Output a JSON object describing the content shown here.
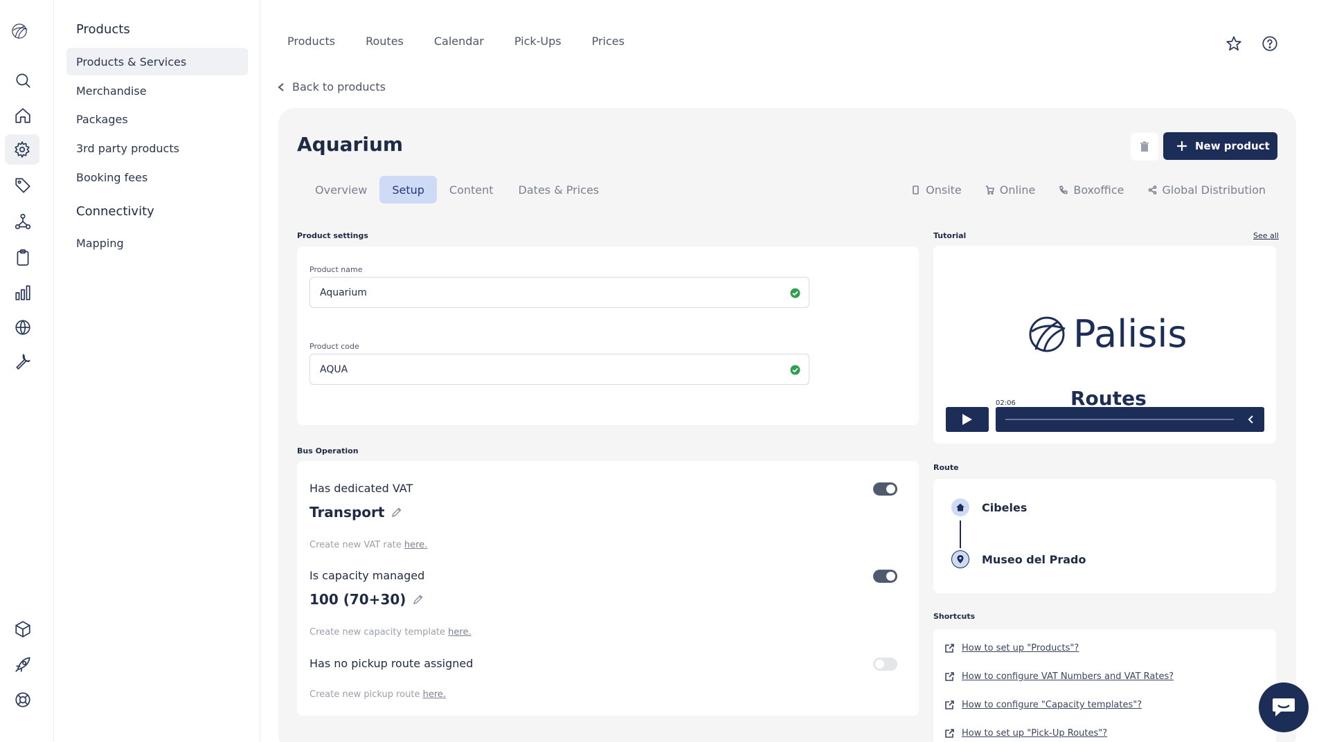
{
  "sidebar": {
    "section_products": "Products",
    "items_products": [
      "Products & Services",
      "Merchandise",
      "Packages",
      "3rd party products",
      "Booking fees"
    ],
    "section_connectivity": "Connectivity",
    "items_connectivity": [
      "Mapping"
    ]
  },
  "topnav": [
    "Products",
    "Routes",
    "Calendar",
    "Pick-Ups",
    "Prices"
  ],
  "back_label": "Back to products",
  "product": {
    "title": "Aquarium",
    "new_button": "New product",
    "tabs": [
      "Overview",
      "Setup",
      "Content",
      "Dates & Prices"
    ],
    "active_tab": "Setup",
    "channels": [
      "Onsite",
      "Online",
      "Boxoffice",
      "Global Distribution"
    ]
  },
  "settings": {
    "section_label": "Product settings",
    "name_label": "Product name",
    "name_value": "Aquarium",
    "code_label": "Product code",
    "code_value": "AQUA"
  },
  "bus": {
    "section_label": "Bus Operation",
    "vat_label": "Has dedicated VAT",
    "vat_value": "Transport",
    "vat_hint": "Create new VAT rate ",
    "vat_link": "here.",
    "vat_on": true,
    "capacity_label": "Is capacity managed",
    "capacity_value": "100 (70+30)",
    "capacity_hint": "Create new capacity template ",
    "capacity_link": "here.",
    "capacity_on": true,
    "pickup_label": "Has no pickup route assigned",
    "pickup_hint": "Create new pickup route ",
    "pickup_link": "here.",
    "pickup_on": false
  },
  "tutorial": {
    "label": "Tutorial",
    "see_all": "See all",
    "brand": "Palisis",
    "subtitle": "Routes",
    "time": "02:06"
  },
  "route": {
    "label": "Route",
    "stops": [
      "Cibeles",
      "Museo del Prado"
    ]
  },
  "shortcuts": {
    "label": "Shortcuts",
    "links": [
      "How to set up \"Products\"?",
      "How to configure VAT Numbers and VAT Rates?",
      "How to configure \"Capacity templates\"?",
      "How to set up \"Pick-Up Routes\"?"
    ]
  },
  "colors": {
    "brand": "#1c2d57",
    "tab_active": "#cfdaf7",
    "panel": "#f5f5f5",
    "success": "#2e9e4f"
  }
}
